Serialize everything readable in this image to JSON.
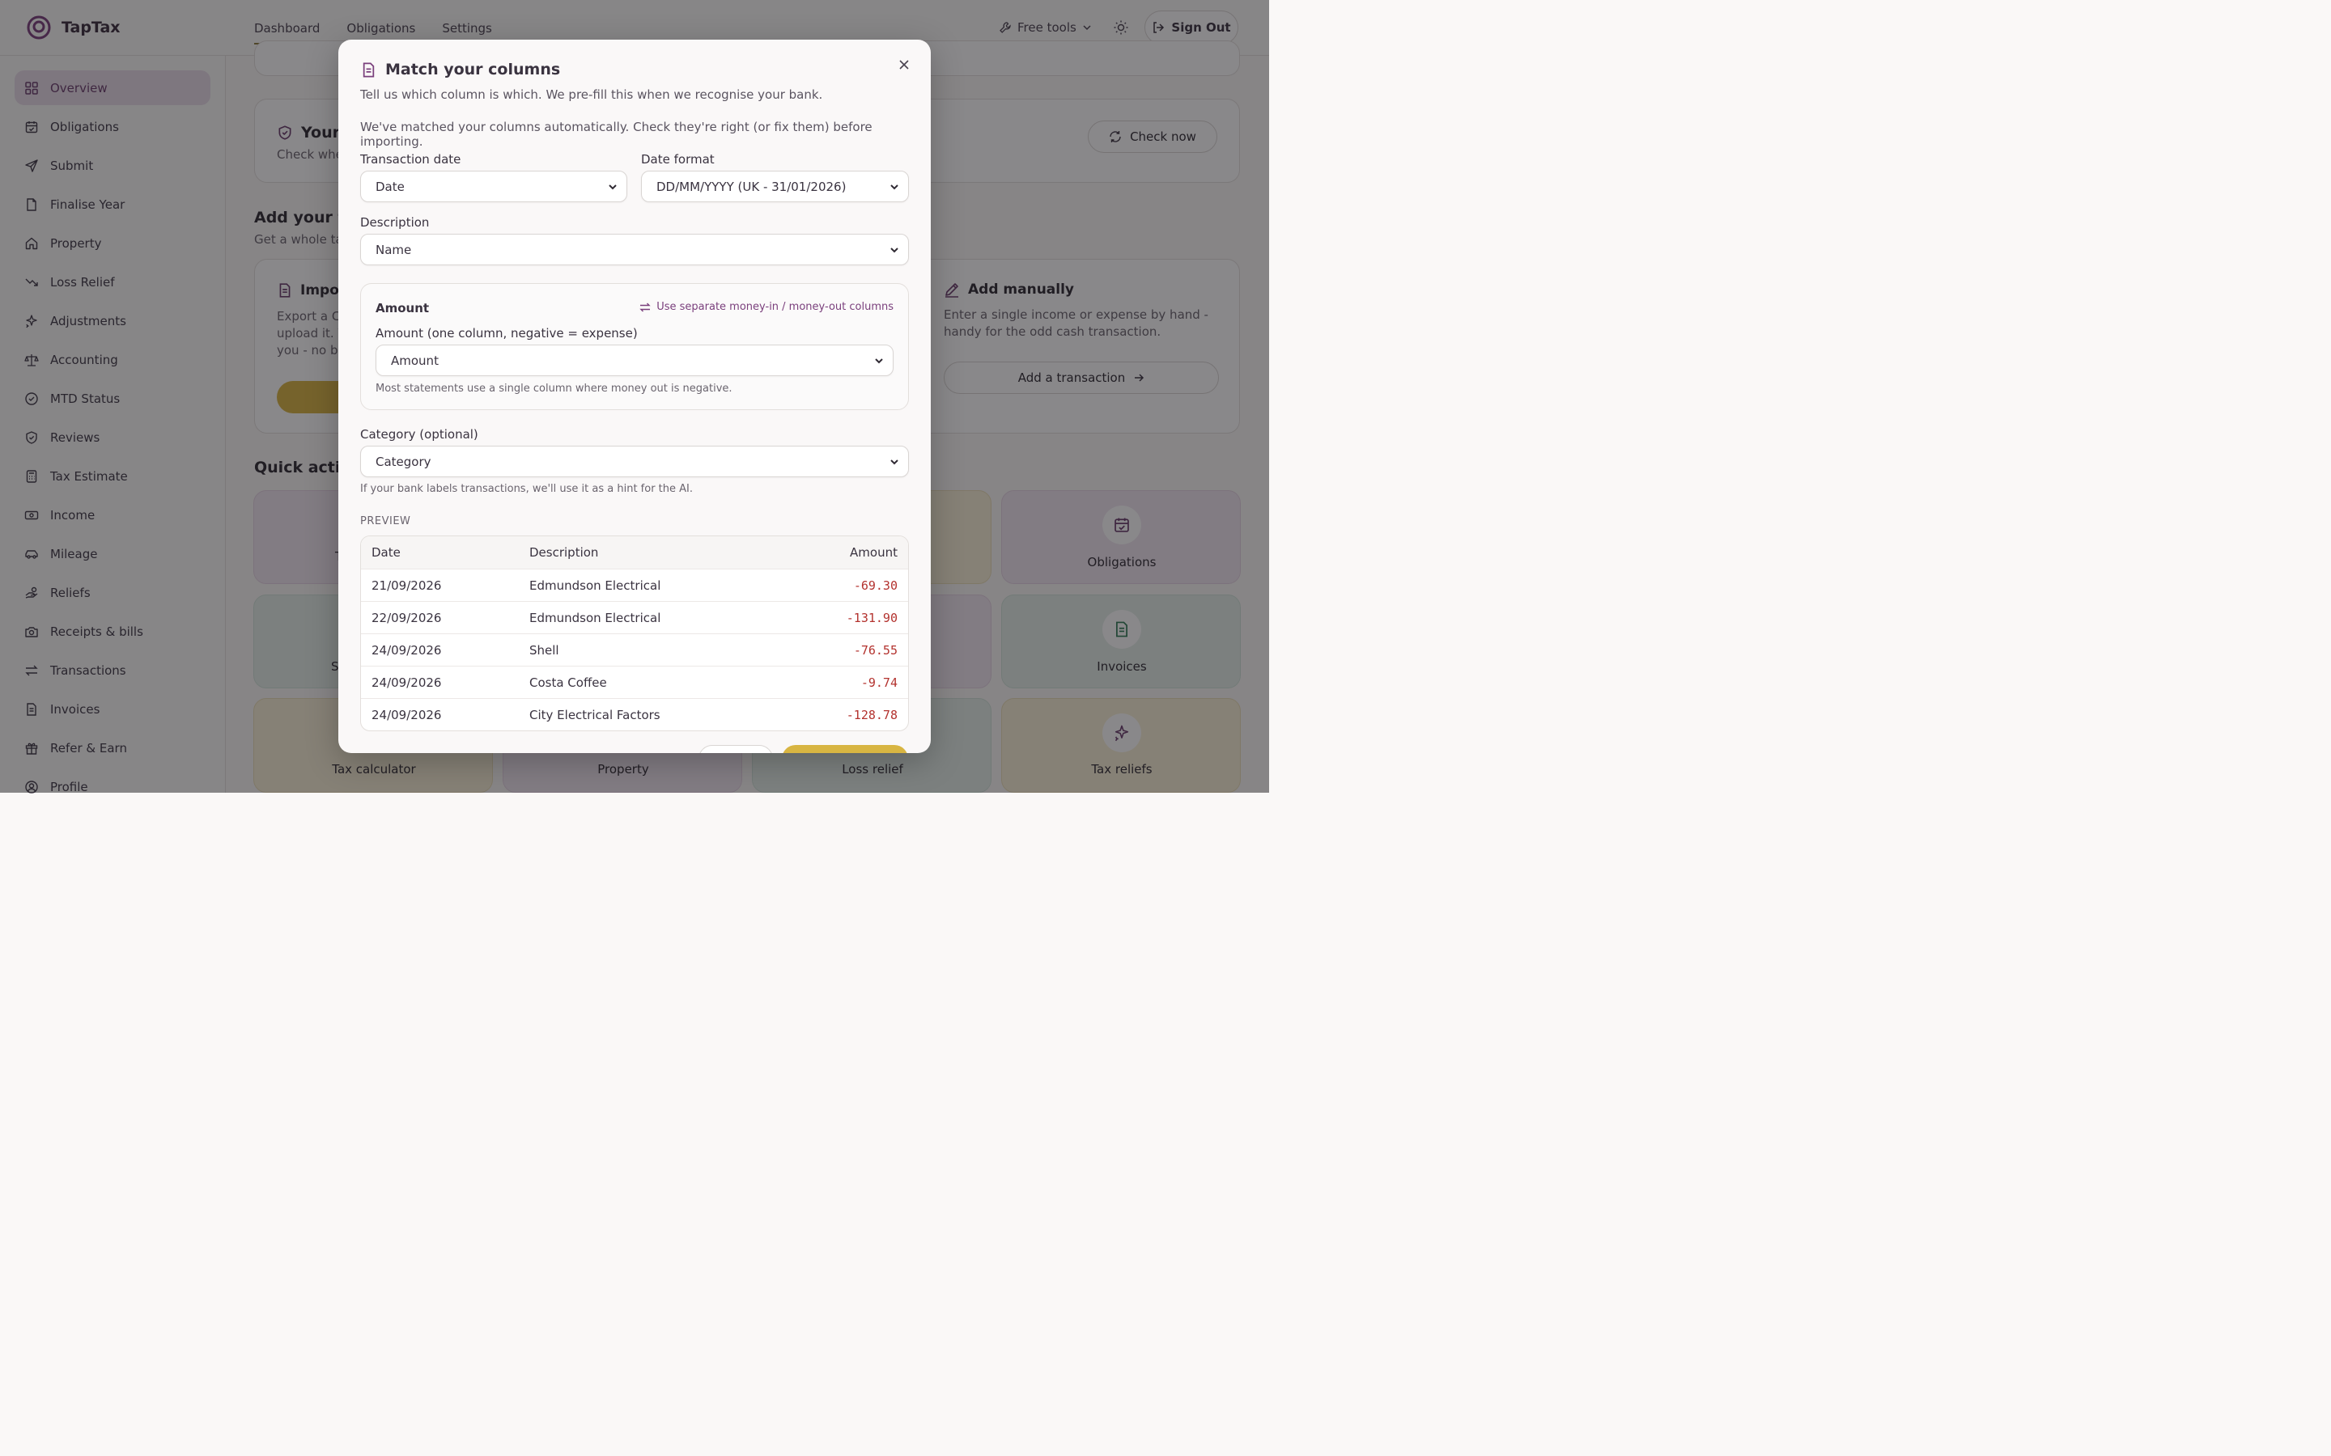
{
  "brand": {
    "name": "TapTax"
  },
  "nav": {
    "items": [
      "Dashboard",
      "Obligations",
      "Settings"
    ],
    "active": "Dashboard"
  },
  "header": {
    "free_tools": "Free tools",
    "sign_out": "Sign Out"
  },
  "sidebar": {
    "items": [
      {
        "label": "Overview",
        "icon": "grid-icon"
      },
      {
        "label": "Obligations",
        "icon": "calendar-check-icon"
      },
      {
        "label": "Submit",
        "icon": "send-icon"
      },
      {
        "label": "Finalise Year",
        "icon": "file-icon"
      },
      {
        "label": "Property",
        "icon": "home-icon"
      },
      {
        "label": "Loss Relief",
        "icon": "trending-down-icon"
      },
      {
        "label": "Adjustments",
        "icon": "sparkles-icon"
      },
      {
        "label": "Accounting",
        "icon": "scale-icon"
      },
      {
        "label": "MTD Status",
        "icon": "check-circle-icon"
      },
      {
        "label": "Reviews",
        "icon": "shield-check-icon"
      },
      {
        "label": "Tax Estimate",
        "icon": "calculator-icon"
      },
      {
        "label": "Income",
        "icon": "banknote-icon"
      },
      {
        "label": "Mileage",
        "icon": "car-icon"
      },
      {
        "label": "Reliefs",
        "icon": "hand-coins-icon"
      },
      {
        "label": "Receipts & bills",
        "icon": "camera-icon"
      },
      {
        "label": "Transactions",
        "icon": "arrows-icon"
      },
      {
        "label": "Invoices",
        "icon": "file-text-icon"
      },
      {
        "label": "Refer & Earn",
        "icon": "gift-icon"
      },
      {
        "label": "Profile",
        "icon": "user-icon"
      }
    ]
  },
  "main": {
    "status_card": {
      "title": "Your",
      "text": "Check whe",
      "button": "Check now"
    },
    "add_title": "Add your tr",
    "add_sub": "Get a whole ta",
    "import_card": {
      "title": "Impor",
      "text1": "Export a C",
      "text2": "upload it. V",
      "text3": "you - no ba"
    },
    "manual_card": {
      "title": "Add manually",
      "text1": "Enter a single income or expense by hand -",
      "text2": "handy for the odd cash transaction.",
      "button": "Add a transaction"
    },
    "quick_title": "Quick action",
    "tiles": [
      {
        "label": "Obligations"
      },
      {
        "label": "Invoices"
      },
      {
        "label": "Tax calculator"
      },
      {
        "label": "Property"
      },
      {
        "label": "Loss relief"
      },
      {
        "label": "Tax reliefs"
      }
    ],
    "tile_fragments": {
      "row1_left": "T",
      "row2_left": "S"
    }
  },
  "modal": {
    "title": "Match your columns",
    "subtitle": "Tell us which column is which. We pre-fill this when we recognise your bank.",
    "note": "We've matched your columns automatically. Check they're right (or fix them) before importing.",
    "transaction_date": {
      "label": "Transaction date",
      "value": "Date"
    },
    "date_format": {
      "label": "Date format",
      "value": "DD/MM/YYYY (UK - 31/01/2026)"
    },
    "description": {
      "label": "Description",
      "value": "Name"
    },
    "amount": {
      "heading": "Amount",
      "switch_link": "Use separate money-in / money-out columns",
      "label": "Amount (one column, negative = expense)",
      "value": "Amount",
      "hint": "Most statements use a single column where money out is negative."
    },
    "category": {
      "label": "Category (optional)",
      "value": "Category",
      "hint": "If your bank labels transactions, we'll use it as a hint for the AI."
    },
    "preview": {
      "label": "PREVIEW",
      "columns": [
        "Date",
        "Description",
        "Amount"
      ],
      "rows": [
        {
          "date": "21/09/2026",
          "description": "Edmundson Electrical",
          "amount": "-69.30"
        },
        {
          "date": "22/09/2026",
          "description": "Edmundson Electrical",
          "amount": "-131.90"
        },
        {
          "date": "24/09/2026",
          "description": "Shell",
          "amount": "-76.55"
        },
        {
          "date": "24/09/2026",
          "description": "Costa Coffee",
          "amount": "-9.74"
        },
        {
          "date": "24/09/2026",
          "description": "City Electrical Factors",
          "amount": "-128.78"
        }
      ]
    }
  },
  "colors": {
    "accent": "#7a3f7c",
    "gold": "#d8b542",
    "negative": "#b3322e"
  }
}
